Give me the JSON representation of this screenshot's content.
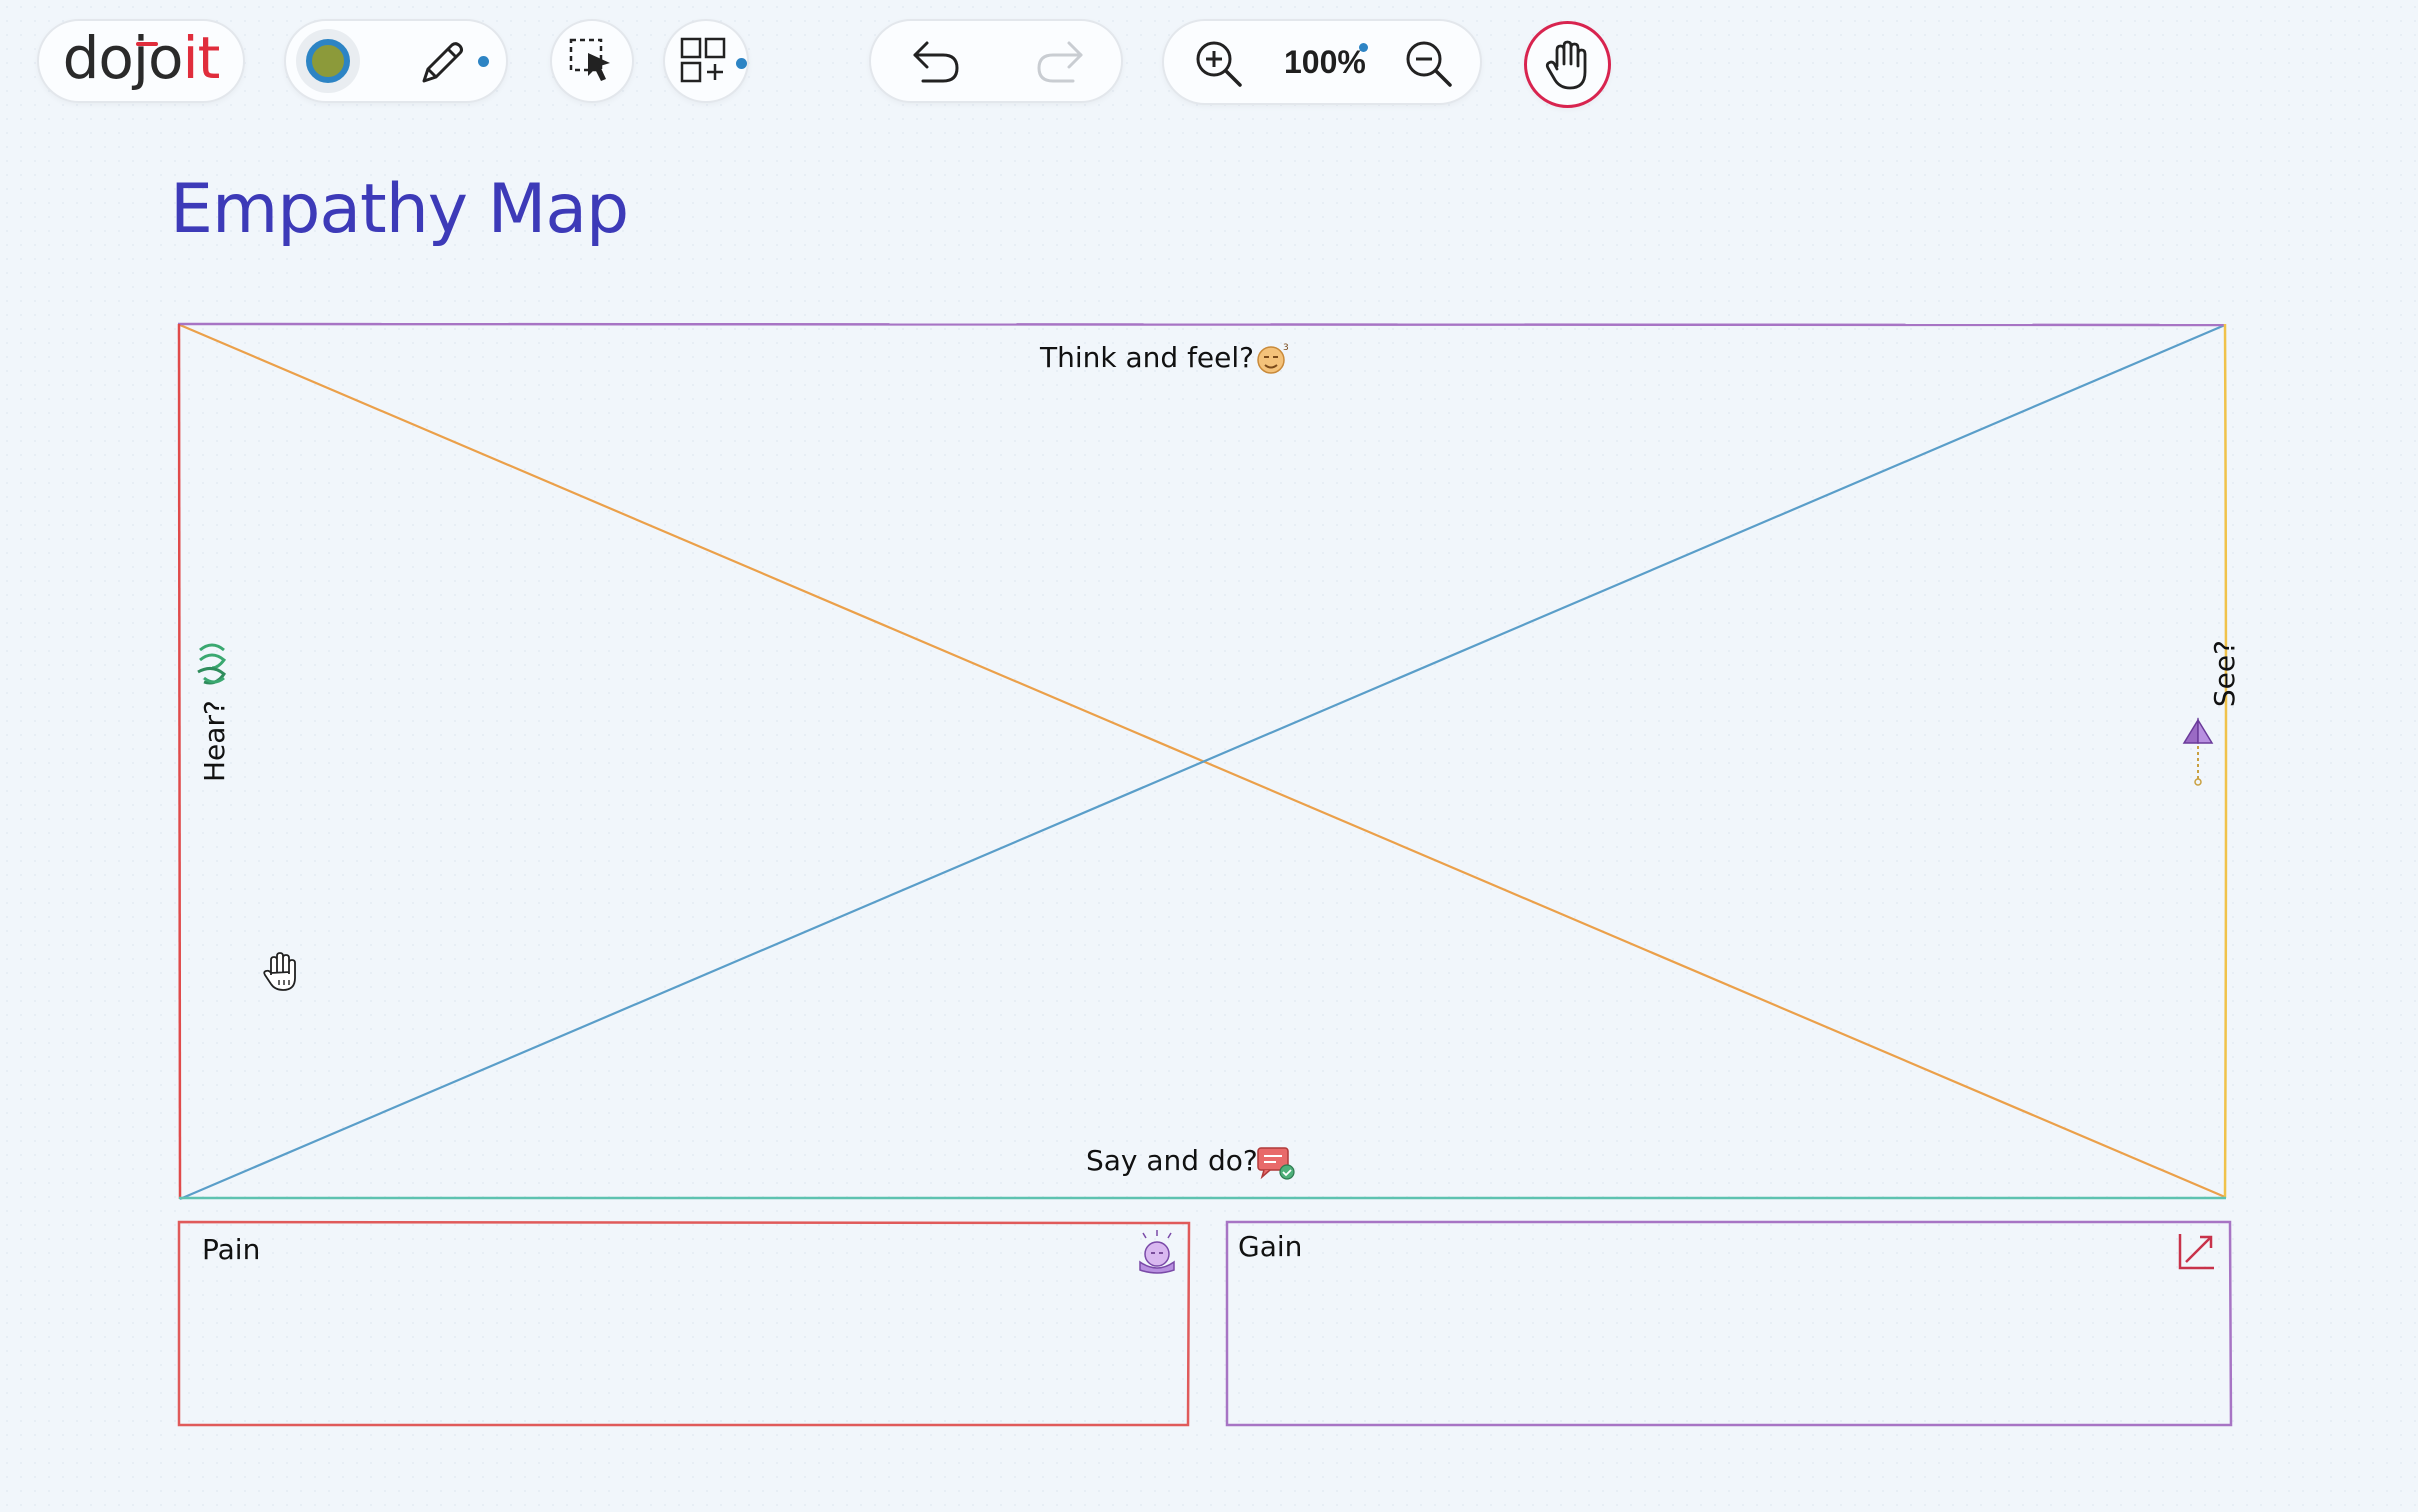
{
  "toolbar": {
    "logo": {
      "text_main": "doj",
      "text_o": "o",
      "text_accent": "it"
    },
    "color_swatch": {
      "fill": "#8c9a3a",
      "ring": "#2d84c4"
    },
    "zoom_level": "100%"
  },
  "canvas": {
    "title": "Empathy Map",
    "quadrants": {
      "top": "Think and feel?",
      "bottom": "Say and do?",
      "left": "Hear?",
      "right": "See?"
    },
    "boxes": {
      "pain": "Pain",
      "gain": "Gain"
    }
  },
  "colors": {
    "accent_blue": "#2d84c4",
    "title": "#3d3ab8",
    "border_top": "#a774c4",
    "border_left": "#e04a4a",
    "border_right": "#f0c24a",
    "border_bottom": "#5ec2b0",
    "diag_orange": "#eba04a",
    "diag_blue": "#5a9ec9",
    "pain_border": "#e05a5a",
    "gain_border": "#a774c4",
    "hand_active": "#d8244f"
  }
}
